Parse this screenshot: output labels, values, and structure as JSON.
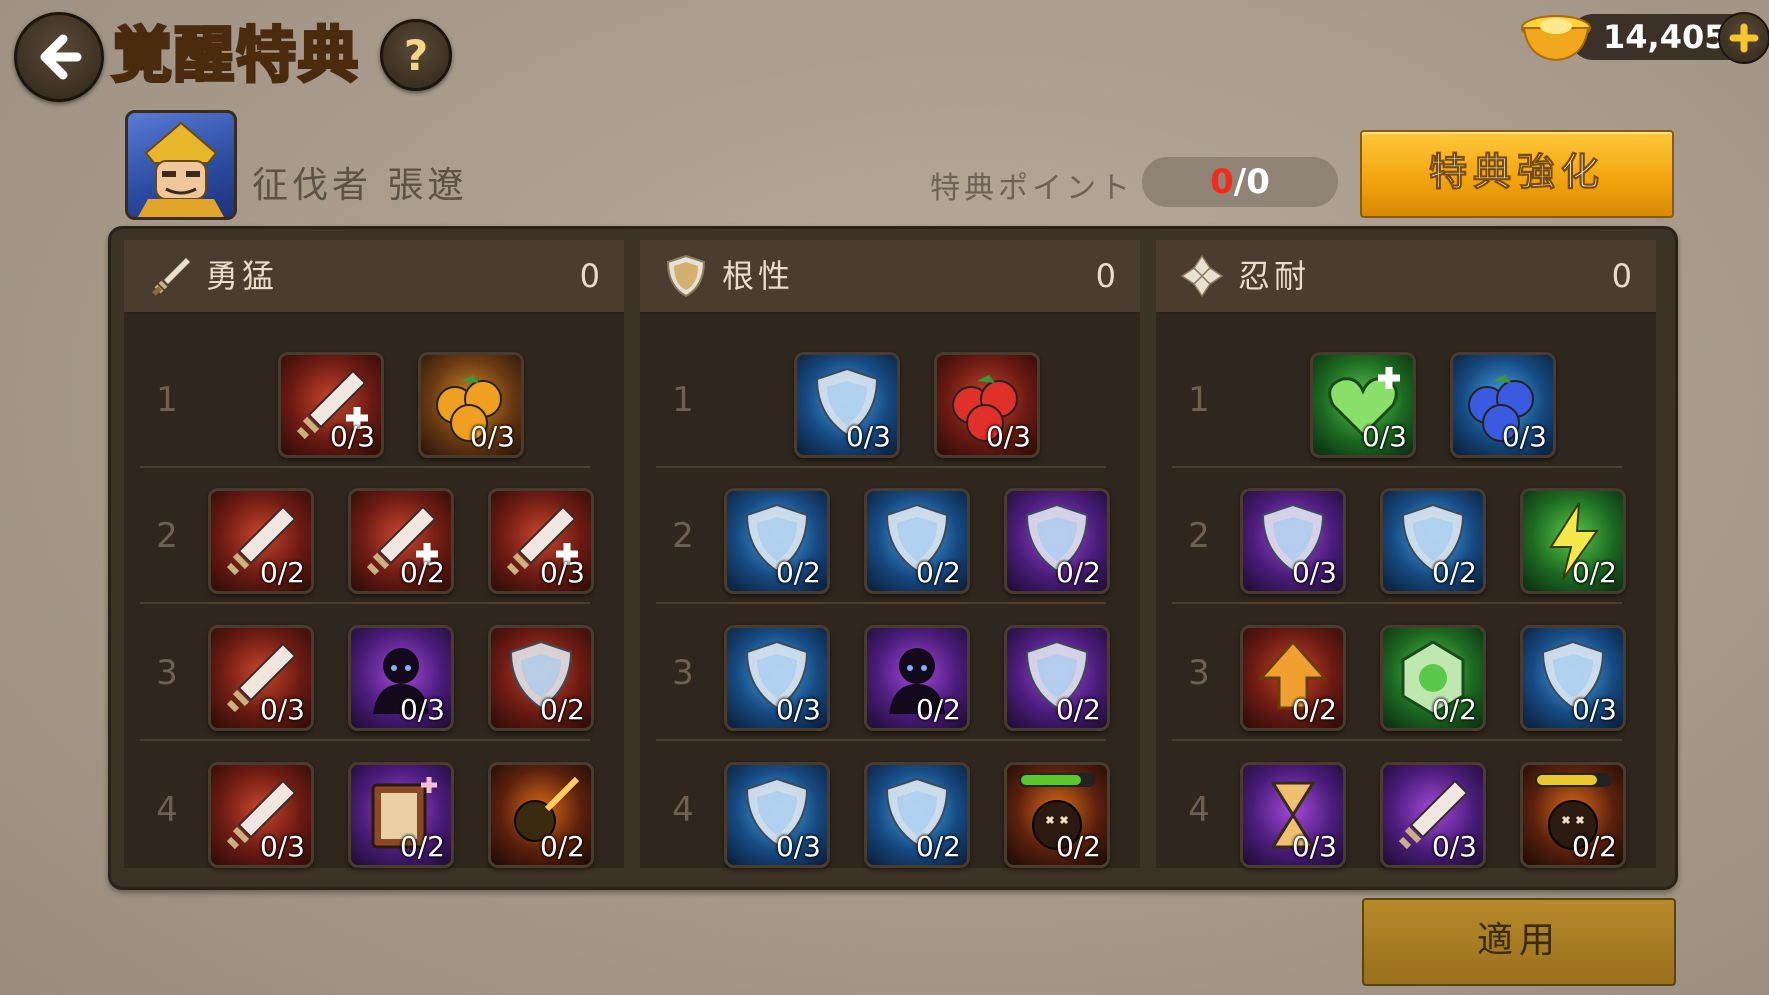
{
  "header": {
    "title": "覚醒特典",
    "help_label": "?",
    "currency": {
      "value": "14,405"
    }
  },
  "hero": {
    "name": "征伐者 張遼"
  },
  "points": {
    "label": "特典ポイント",
    "current": "0",
    "max": "/0"
  },
  "buttons": {
    "enhance": "特典強化",
    "apply": "適用"
  },
  "colors": {
    "accent": "#f0a20c",
    "title": "#f7d14a",
    "points_current": "#f12a1c"
  },
  "columns": [
    {
      "title": "勇猛",
      "points": "0",
      "icon": "sword-icon",
      "rows": [
        {
          "num": "1",
          "skills": [
            {
              "icon": "sword-plus-icon",
              "count": "0/3",
              "bg": "red"
            },
            {
              "icon": "gold-berries-icon",
              "count": "0/3",
              "bg": "gold"
            }
          ]
        },
        {
          "num": "2",
          "skills": [
            {
              "icon": "sword-spirit-icon",
              "count": "0/2",
              "bg": "red"
            },
            {
              "icon": "sword-slash-plus-icon",
              "count": "0/2",
              "bg": "red"
            },
            {
              "icon": "slash-plus-icon",
              "count": "0/3",
              "bg": "red"
            }
          ]
        },
        {
          "num": "3",
          "skills": [
            {
              "icon": "crossed-swords-icon",
              "count": "0/3",
              "bg": "red"
            },
            {
              "icon": "shadow-eyes-icon",
              "count": "0/3",
              "bg": "purple"
            },
            {
              "icon": "broken-shield-arrow-icon",
              "count": "0/2",
              "bg": "red"
            }
          ]
        },
        {
          "num": "4",
          "skills": [
            {
              "icon": "winged-sword-icon",
              "count": "0/3",
              "bg": "red"
            },
            {
              "icon": "spellbook-icon",
              "count": "0/2",
              "bg": "purple"
            },
            {
              "icon": "fist-strike-icon",
              "count": "0/2",
              "bg": "dark"
            }
          ]
        }
      ]
    },
    {
      "title": "根性",
      "points": "0",
      "icon": "shield-icon",
      "rows": [
        {
          "num": "1",
          "skills": [
            {
              "icon": "shield-glow-icon",
              "count": "0/3",
              "bg": "blue"
            },
            {
              "icon": "red-berries-icon",
              "count": "0/3",
              "bg": "red"
            }
          ]
        },
        {
          "num": "2",
          "skills": [
            {
              "icon": "shield-arm-icon",
              "count": "0/2",
              "bg": "blue"
            },
            {
              "icon": "shield-spark-icon",
              "count": "0/2",
              "bg": "blue"
            },
            {
              "icon": "broken-shield-icon",
              "count": "0/2",
              "bg": "purple"
            }
          ]
        },
        {
          "num": "3",
          "skills": [
            {
              "icon": "winged-shield-icon",
              "count": "0/3",
              "bg": "blue"
            },
            {
              "icon": "dark-figure-icon",
              "count": "0/2",
              "bg": "purple"
            },
            {
              "icon": "shield-aura-icon",
              "count": "0/2",
              "bg": "purple"
            }
          ]
        },
        {
          "num": "4",
          "skills": [
            {
              "icon": "armored-shield-icon",
              "count": "0/3",
              "bg": "blue"
            },
            {
              "icon": "shield-silhouette-icon",
              "count": "0/2",
              "bg": "blue"
            },
            {
              "icon": "knockout-bar-green-icon",
              "count": "0/2",
              "bg": "dark"
            }
          ]
        }
      ]
    },
    {
      "title": "忍耐",
      "points": "0",
      "icon": "clover-icon",
      "rows": [
        {
          "num": "1",
          "skills": [
            {
              "icon": "heart-plus-icon",
              "count": "0/3",
              "bg": "green"
            },
            {
              "icon": "blue-berries-icon",
              "count": "0/3",
              "bg": "blue"
            }
          ]
        },
        {
          "num": "2",
          "skills": [
            {
              "icon": "purple-shield-icon",
              "count": "0/3",
              "bg": "purple"
            },
            {
              "icon": "ice-shield-icon",
              "count": "0/2",
              "bg": "blue"
            },
            {
              "icon": "lightning-plus-icon",
              "count": "0/2",
              "bg": "green"
            }
          ]
        },
        {
          "num": "3",
          "skills": [
            {
              "icon": "up-arrow-icon",
              "count": "0/2",
              "bg": "red"
            },
            {
              "icon": "green-emblem-icon",
              "count": "0/2",
              "bg": "green"
            },
            {
              "icon": "lightning-shield-icon",
              "count": "0/3",
              "bg": "blue"
            }
          ]
        },
        {
          "num": "4",
          "skills": [
            {
              "icon": "hourglass-icon",
              "count": "0/3",
              "bg": "purple"
            },
            {
              "icon": "sword-barrier-icon",
              "count": "0/3",
              "bg": "purple"
            },
            {
              "icon": "knockout-bar-yellow-icon",
              "count": "0/2",
              "bg": "dark"
            }
          ]
        }
      ]
    }
  ]
}
